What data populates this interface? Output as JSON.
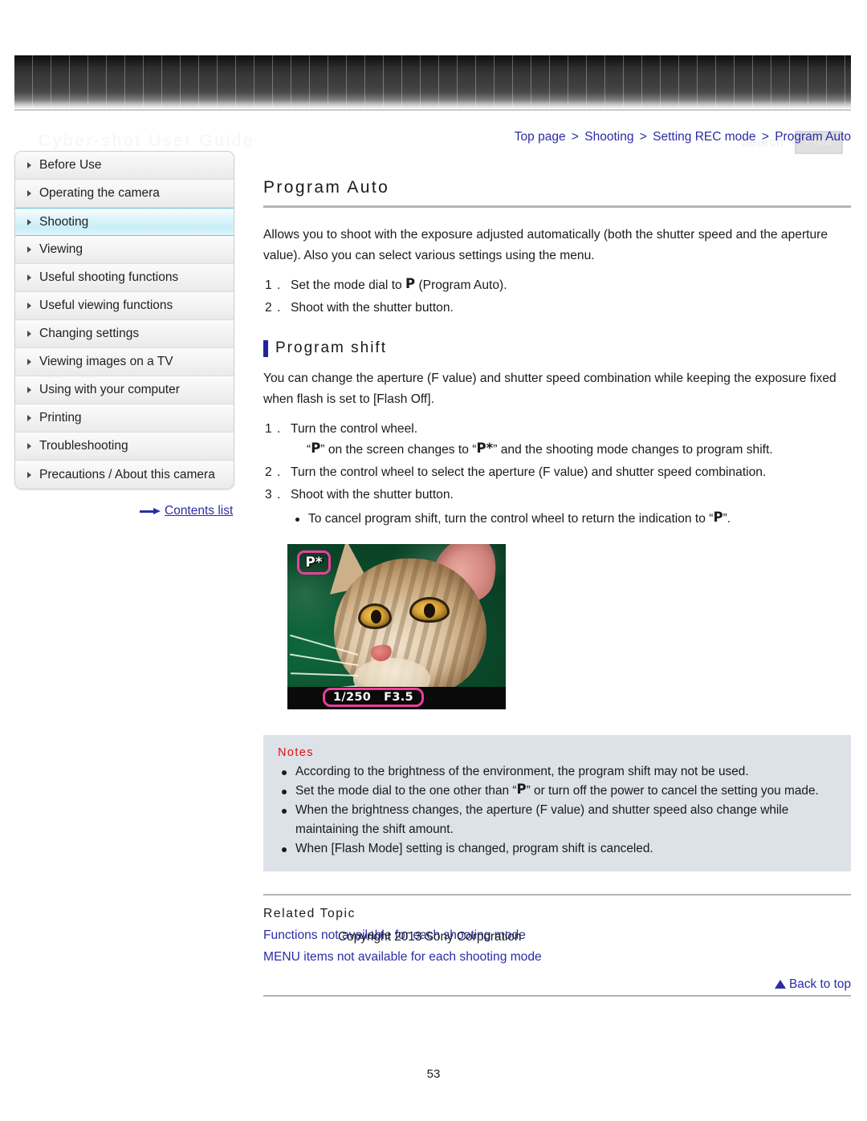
{
  "header": {
    "title": "Cyber-shot User Guide",
    "search_label": "Search",
    "print_label": "Print"
  },
  "breadcrumb": {
    "items": [
      "Top page",
      "Shooting",
      "Setting REC mode",
      "Program Auto"
    ],
    "separator": ">",
    "full": "Top page > Shooting > Setting REC mode > Program Auto"
  },
  "sidebar": {
    "items": [
      {
        "label": "Before Use",
        "active": false
      },
      {
        "label": "Operating the camera",
        "active": false
      },
      {
        "label": "Shooting",
        "active": true
      },
      {
        "label": "Viewing",
        "active": false
      },
      {
        "label": "Useful shooting functions",
        "active": false
      },
      {
        "label": "Useful viewing functions",
        "active": false
      },
      {
        "label": "Changing settings",
        "active": false
      },
      {
        "label": "Viewing images on a TV",
        "active": false
      },
      {
        "label": "Using with your computer",
        "active": false
      },
      {
        "label": "Printing",
        "active": false
      },
      {
        "label": "Troubleshooting",
        "active": false
      },
      {
        "label": "Precautions / About this camera",
        "active": false
      }
    ],
    "contents_list_label": "Contents list"
  },
  "main": {
    "title": "Program Auto",
    "intro": "Allows you to shoot with the exposure adjusted automatically (both the shutter speed and the aperture value). Also you can select various settings using the menu.",
    "steps": [
      {
        "pre": "Set the mode dial to ",
        "glyph": "P",
        "post": " (Program Auto)."
      },
      {
        "pre": "Shoot with the shutter button.",
        "glyph": "",
        "post": ""
      }
    ],
    "program_shift": {
      "heading": "Program shift",
      "intro": "You can change the aperture (F value) and shutter speed combination while keeping the exposure fixed when flash is set to [Flash Off].",
      "step1_main": "Turn the control wheel.",
      "step1_sub_a": "“",
      "step1_sub_glyph1": "P",
      "step1_sub_b": "” on the screen changes to “",
      "step1_sub_glyph2": "P*",
      "step1_sub_c": "” and the shooting mode changes to program shift.",
      "step2": "Turn the control wheel to select the aperture (F value) and shutter speed combination.",
      "step3": "Shoot with the shutter button.",
      "bullet_a": "To cancel program shift, turn the control wheel to return the indication to “",
      "bullet_glyph": "P",
      "bullet_b": "”."
    }
  },
  "photo": {
    "mode_badge": "P",
    "mode_badge_star": "*",
    "shutter_speed": "1/250",
    "aperture": "F3.5",
    "subject": "cat",
    "highlight_color": "#ea3f9b"
  },
  "notes": {
    "title": "Notes",
    "items": [
      {
        "pre": "According to the brightness of the environment, the program shift may not be used.",
        "glyph": "",
        "post": ""
      },
      {
        "pre": "Set the mode dial to the one other than “",
        "glyph": "P",
        "post": "” or turn off the power to cancel the setting you made."
      },
      {
        "pre": "When the brightness changes, the aperture (F value) and shutter speed also change while maintaining the shift amount.",
        "glyph": "",
        "post": ""
      },
      {
        "pre": "When [Flash Mode] setting is changed, program shift is canceled.",
        "glyph": "",
        "post": ""
      }
    ]
  },
  "related": {
    "title": "Related Topic",
    "links": [
      "Functions not available for each shooting mode",
      "MENU items not available for each shooting mode"
    ],
    "back_to_top": "Back to top"
  },
  "footer": {
    "copyright": "Copyright 2013 Sony Corporation",
    "page_number": "53"
  },
  "colors": {
    "link": "#2b2ba8",
    "notes_title": "#e01010",
    "notes_bg": "#dde1e8",
    "accent_bar": "#2222a0",
    "active_nav": "#c9eef7"
  }
}
